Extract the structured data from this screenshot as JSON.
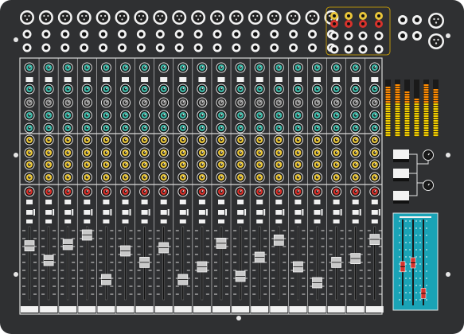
{
  "device": {
    "name": "",
    "channel_count": 19
  },
  "colors": {
    "body": "#2f3032",
    "panel_line": "#d9d9d9",
    "knob_teal": "#3fb8a8",
    "knob_grey": "#9a9a9a",
    "knob_yellow": "#e9c63a",
    "knob_red": "#d8322c",
    "meter_low": "#f5d000",
    "meter_high": "#ff8a00",
    "master_panel": "#1aa3b6",
    "master_led": "#d8322c"
  },
  "channels": [
    {
      "fader_level": 0.78
    },
    {
      "fader_level": 0.55
    },
    {
      "fader_level": 0.8
    },
    {
      "fader_level": 0.95
    },
    {
      "fader_level": 0.25
    },
    {
      "fader_level": 0.7
    },
    {
      "fader_level": 0.52
    },
    {
      "fader_level": 0.75
    },
    {
      "fader_level": 0.25
    },
    {
      "fader_level": 0.45
    },
    {
      "fader_level": 0.82
    },
    {
      "fader_level": 0.3
    },
    {
      "fader_level": 0.6
    },
    {
      "fader_level": 0.87
    },
    {
      "fader_level": 0.45
    },
    {
      "fader_level": 0.2
    },
    {
      "fader_level": 0.52
    },
    {
      "fader_level": 0.58
    },
    {
      "fader_level": 0.88
    }
  ],
  "meters": [
    0.88,
    0.93,
    0.82,
    0.68,
    0.92,
    0.85
  ],
  "master_faders": [
    0.45,
    0.5,
    0.1
  ]
}
